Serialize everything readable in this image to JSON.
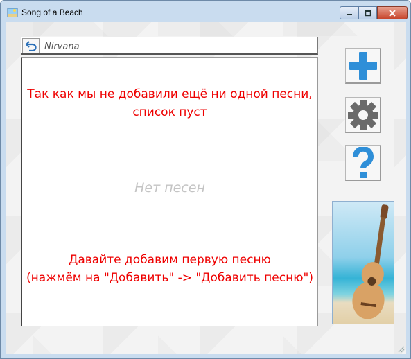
{
  "window": {
    "title": "Song of a Beach"
  },
  "search": {
    "value": "Nirvana"
  },
  "list": {
    "message_top": [
      "Так как мы не добавили ещё ни одной песни,",
      "список пуст"
    ],
    "empty_label": "Нет песен",
    "message_bottom": [
      "Давайте добавим первую песню",
      "(нажмём на \"Добавить\" -> \"Добавить песню\")"
    ]
  },
  "sidebar": {
    "buttons": [
      {
        "icon": "plus-icon",
        "color": "#2f8fd8"
      },
      {
        "icon": "gear-icon",
        "color": "#6a6a6a"
      },
      {
        "icon": "question-icon",
        "color": "#2f8fd8"
      }
    ],
    "image": "ukulele-on-beach"
  },
  "colors": {
    "message": "#ee0000",
    "placeholder": "#c4c4c4",
    "accent": "#2f8fd8"
  }
}
